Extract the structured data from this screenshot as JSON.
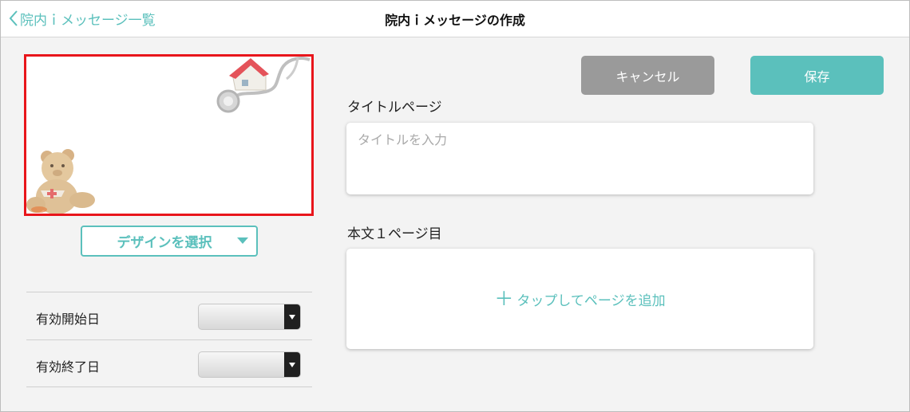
{
  "header": {
    "back_label": "院内ｉメッセージ一覧",
    "title": "院内ｉメッセージの作成"
  },
  "preview": {
    "design_button_label": "デザインを選択"
  },
  "dates": {
    "start_label": "有効開始日",
    "end_label": "有効終了日"
  },
  "actions": {
    "cancel_label": "キャンセル",
    "save_label": "保存"
  },
  "title_page": {
    "label": "タイトルページ",
    "placeholder": "タイトルを入力"
  },
  "body_page": {
    "label": "本文１ページ目",
    "add_plus": "＋",
    "add_label": "タップしてページを追加"
  },
  "colors": {
    "accent": "#5bc0bc",
    "cancel": "#9a9a9a",
    "highlight_border": "#e8151b"
  }
}
